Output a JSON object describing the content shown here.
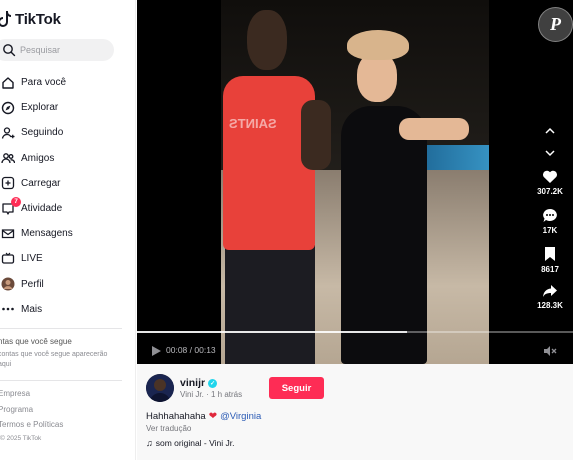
{
  "app": {
    "name": "TikTok"
  },
  "search": {
    "placeholder": "Pesquisar"
  },
  "sidebar": {
    "items": [
      {
        "label": "Para você",
        "icon": "home-icon"
      },
      {
        "label": "Explorar",
        "icon": "compass-icon"
      },
      {
        "label": "Seguindo",
        "icon": "user-plus-icon"
      },
      {
        "label": "Amigos",
        "icon": "friends-icon"
      },
      {
        "label": "Carregar",
        "icon": "upload-icon"
      },
      {
        "label": "Atividade",
        "icon": "inbox-icon",
        "badge": "7"
      },
      {
        "label": "Mensagens",
        "icon": "message-icon"
      },
      {
        "label": "LIVE",
        "icon": "live-icon"
      },
      {
        "label": "Perfil",
        "icon": "avatar"
      },
      {
        "label": "Mais",
        "icon": "more-icon"
      }
    ],
    "following_title": "ntas que você segue",
    "following_desc": "contas que você segue aparecerão\naqui",
    "footer_links": [
      "Empresa",
      "Programa",
      "Termos e Políticas"
    ],
    "copyright": "© 2025 TikTok"
  },
  "video": {
    "watermark": "P",
    "time_current": "00:08",
    "time_total": "00:13",
    "progress": 0.62,
    "shirt_text": "SAINTS"
  },
  "actions": {
    "likes": "307.2K",
    "comments": "17K",
    "saves": "8617",
    "shares": "128.3K"
  },
  "post": {
    "username": "vinijr",
    "display_name": "Vini Jr.",
    "time_ago": "1 h atrás",
    "follow_label": "Seguir",
    "caption_text": "Hahhahahaha",
    "mention": "@Virginia",
    "translate": "Ver tradução",
    "music": "som original - Vini Jr."
  },
  "colors": {
    "accent": "#fe2c55",
    "verified": "#20d5ec",
    "mention": "#2b5bb5"
  }
}
